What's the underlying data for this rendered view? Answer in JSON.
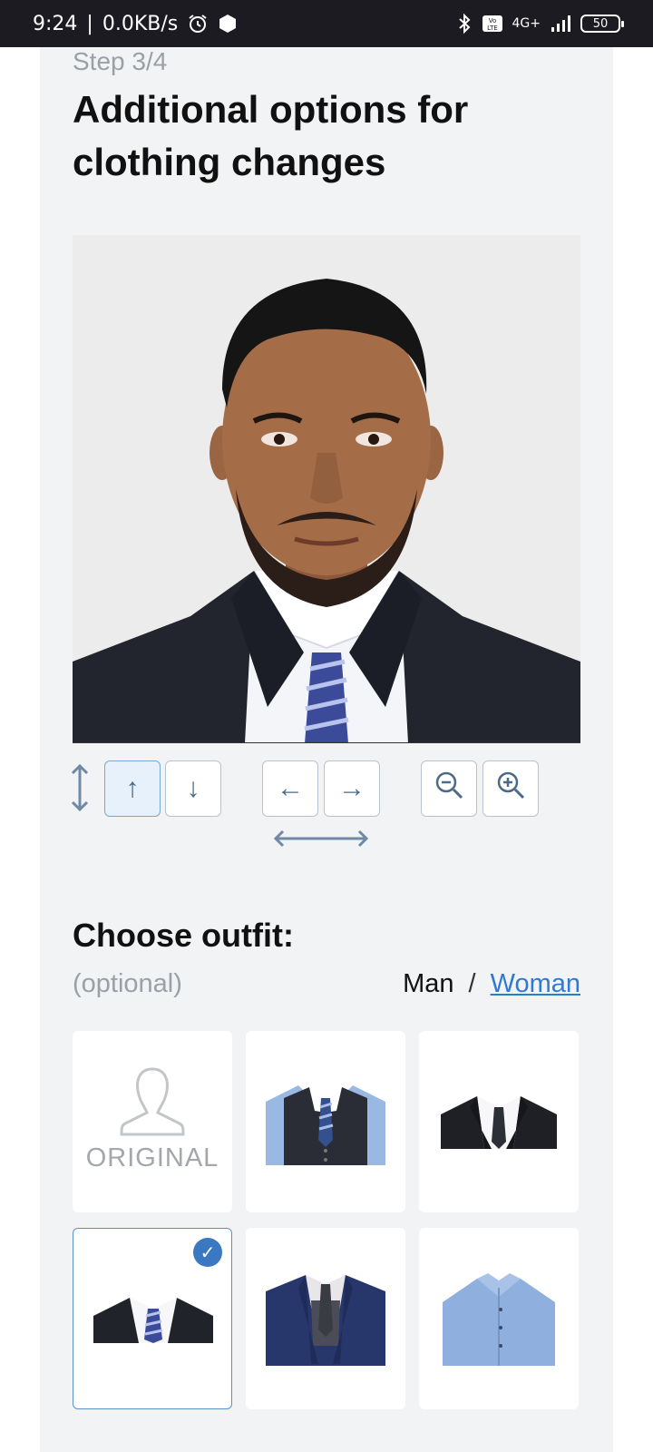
{
  "status": {
    "time": "9:24",
    "speed": "0.0KB/s",
    "net": "4G+",
    "volte": "VoLTE",
    "battery": "50"
  },
  "step": "Step 3/4",
  "title": "Additional options for clothing changes",
  "controls": {
    "up": "↑",
    "down": "↓",
    "left": "←",
    "right": "→"
  },
  "outfit": {
    "title": "Choose outfit:",
    "optional": "(optional)",
    "gender_man": "Man",
    "gender_sep": "/",
    "gender_woman": "Woman",
    "original_label": "ORIGINAL",
    "tiles": [
      {
        "name": "original",
        "selected": false
      },
      {
        "name": "vest-and-tie",
        "selected": false
      },
      {
        "name": "black-suit-black-tie",
        "selected": false
      },
      {
        "name": "black-suit-striped-tie",
        "selected": true
      },
      {
        "name": "navy-suit-vest",
        "selected": false
      },
      {
        "name": "blue-shirt",
        "selected": false
      }
    ]
  },
  "colors": {
    "accent": "#2e7bd6",
    "panel": "#f2f3f5",
    "selected_border": "#5b8fc7"
  }
}
